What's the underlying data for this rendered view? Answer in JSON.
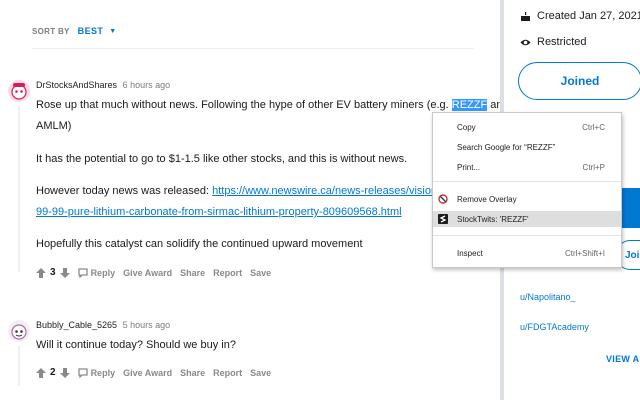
{
  "sort": {
    "label": "SORT BY",
    "value": "BEST"
  },
  "comments": [
    {
      "author": "DrStocksAndShares",
      "time": "6 hours ago",
      "lines": {
        "l1_before": "Rose up that much without news. Following the hype of other EV battery miners (e.g. ",
        "l1_highlight": "REZZF",
        "l1_after": " and",
        "l2": "AMLM)",
        "p2": "It has the potential to go to $1-1.5 like other stocks, and this is without news.",
        "p3_before": "However today news was released: ",
        "p3_link_a": "https://www.newswire.ca/news-releases/vision-lithium-",
        "p3_link_b": "99-99-pure-lithium-carbonate-from-sirmac-lithium-property-809609568.html",
        "p4": "Hopefully this catalyst can solidify the continued upward movement"
      },
      "votes": "3",
      "actions": {
        "reply": "Reply",
        "award": "Give Award",
        "share": "Share",
        "report": "Report",
        "save": "Save"
      }
    },
    {
      "author": "Bubbly_Cable_5265",
      "time": "5 hours ago",
      "text": "Will it continue today? Should we buy in?",
      "votes": "2",
      "actions": {
        "reply": "Reply",
        "award": "Give Award",
        "share": "Share",
        "report": "Report",
        "save": "Save"
      }
    }
  ],
  "sidebar": {
    "created": "Created Jan 27, 2021",
    "restricted": "Restricted",
    "joined": "Joined",
    "outline_button": "Join me",
    "links": [
      "u/Napolitano_",
      "u/FDGTAcademy"
    ],
    "view_all": "VIEW ALL"
  },
  "context_menu": {
    "copy": "Copy",
    "copy_sc": "Ctrl+C",
    "search": "Search Google for “REZZF”",
    "print": "Print...",
    "print_sc": "Ctrl+P",
    "remove_overlay": "Remove Overlay",
    "stocktwits": "StockTwits: 'REZZF'",
    "inspect": "Inspect",
    "inspect_sc": "Ctrl+Shift+I"
  },
  "colors": {
    "accent": "#0079d3",
    "page_bg": "#dae0e6",
    "selection": "#3399ff"
  }
}
